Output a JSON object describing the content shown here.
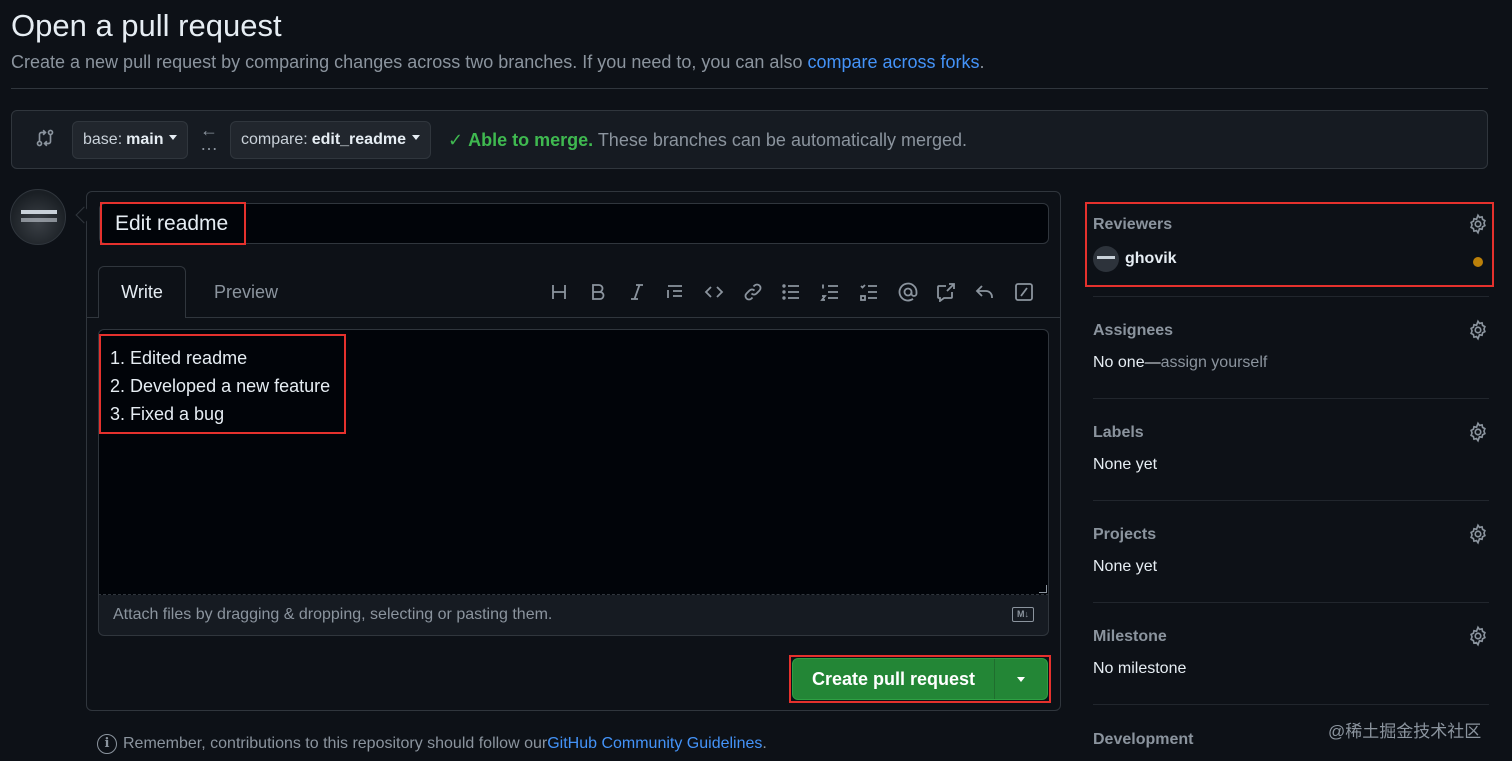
{
  "page": {
    "title": "Open a pull request",
    "subtitle_text": "Create a new pull request by comparing changes across two branches. If you need to, you can also ",
    "subtitle_link": "compare across forks",
    "subtitle_end": "."
  },
  "compare": {
    "base_prefix": "base:",
    "base_branch": "main",
    "compare_prefix": "compare:",
    "compare_branch": "edit_readme",
    "merge_ok": "Able to merge.",
    "merge_text": " These branches can be automatically merged.",
    "merge_color": "#3fb950"
  },
  "form": {
    "title_value": "Edit readme",
    "tabs": [
      {
        "label": "Write"
      },
      {
        "label": "Preview"
      }
    ],
    "toolbar": [
      "heading-icon",
      "bold-icon",
      "italic-icon",
      "quote-icon",
      "code-icon",
      "link-icon",
      "bulleted-list-icon",
      "numbered-list-icon",
      "task-list-icon",
      "mention-icon",
      "cross-reference-icon",
      "saved-replies-icon",
      "slash-commands-icon"
    ],
    "body_lines": [
      "1. Edited readme",
      "2. Developed a new feature",
      "3. Fixed a bug"
    ],
    "attach_text": "Attach files by dragging & dropping, selecting or pasting them.",
    "markdown_badge": "M↓",
    "create_label": "Create pull request",
    "accent": "#238636"
  },
  "footer": {
    "remember_text": "Remember, contributions to this repository should follow our ",
    "guidelines_link": "GitHub Community Guidelines",
    "remember_end": "."
  },
  "sidebar": {
    "reviewers": {
      "label": "Reviewers",
      "user": "ghovik",
      "status_color": "#bb8009"
    },
    "assignees": {
      "label": "Assignees",
      "value": "No one—",
      "link": "assign yourself"
    },
    "labels": {
      "label": "Labels",
      "value": "None yet"
    },
    "projects": {
      "label": "Projects",
      "value": "None yet"
    },
    "milestone": {
      "label": "Milestone",
      "value": "No milestone"
    },
    "development": {
      "label": "Development"
    }
  },
  "watermark": "@稀土掘金技术社区"
}
